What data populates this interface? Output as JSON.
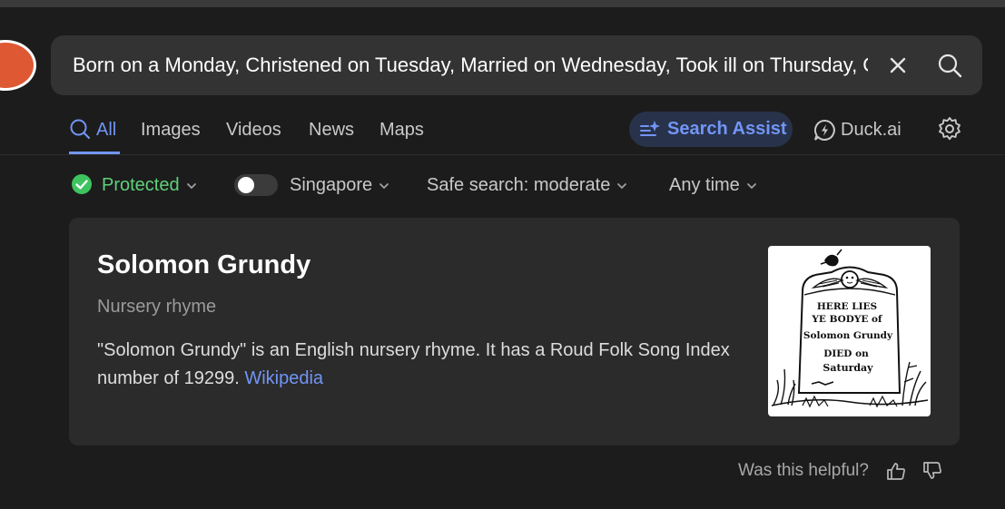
{
  "search": {
    "query": "Born on a Monday, Christened on Tuesday, Married on Wednesday, Took ill on Thursday, Grew worse on Friday, Died on Saturday, Buried on Sunday"
  },
  "nav": {
    "tabs": [
      {
        "label": "All",
        "active": true
      },
      {
        "label": "Images"
      },
      {
        "label": "Videos"
      },
      {
        "label": "News"
      },
      {
        "label": "Maps"
      }
    ],
    "assist_label": "Search Assist",
    "duck_ai_label": "Duck.ai"
  },
  "filters": {
    "protected_label": "Protected",
    "region_label": "Singapore",
    "region_enabled": false,
    "safe_search_label": "Safe search: moderate",
    "time_label": "Any time"
  },
  "card": {
    "title": "Solomon Grundy",
    "subtitle": "Nursery rhyme",
    "description": "\"Solomon Grundy\" is an English nursery rhyme. It has a Roud Folk Song Index number of 19299.",
    "link_label": "Wikipedia",
    "image_lines": [
      "HERE LIES",
      "YE BODYE of",
      "Solomon Grundy",
      "DIED on",
      "Saturday"
    ]
  },
  "feedback": {
    "question": "Was this helpful?"
  },
  "colors": {
    "background": "#1c1c1c",
    "search_bar": "#333333",
    "accent": "#7295f6",
    "protected": "#5fd07a",
    "card": "#2b2b2b",
    "logo": "#de5833"
  }
}
